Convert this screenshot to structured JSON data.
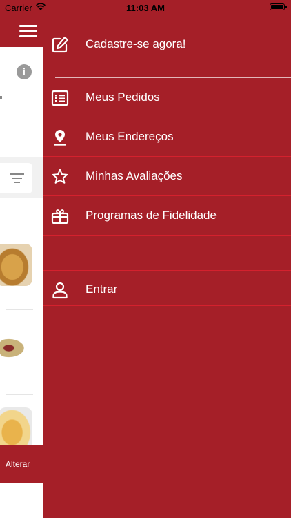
{
  "status_bar": {
    "carrier": "Carrier",
    "time": "11:03 AM"
  },
  "page": {
    "change_button": "Alterar"
  },
  "menu": {
    "signup": "Cadastre-se agora!",
    "items": [
      {
        "label": "Meus Pedidos",
        "icon": "list-icon"
      },
      {
        "label": "Meus Endereços",
        "icon": "location-pin-icon"
      },
      {
        "label": "Minhas Avaliações",
        "icon": "star-icon"
      },
      {
        "label": "Programas de Fidelidade",
        "icon": "gift-icon"
      }
    ],
    "login": "Entrar"
  },
  "colors": {
    "primary": "#a51f28",
    "divider": "#d4212e"
  }
}
